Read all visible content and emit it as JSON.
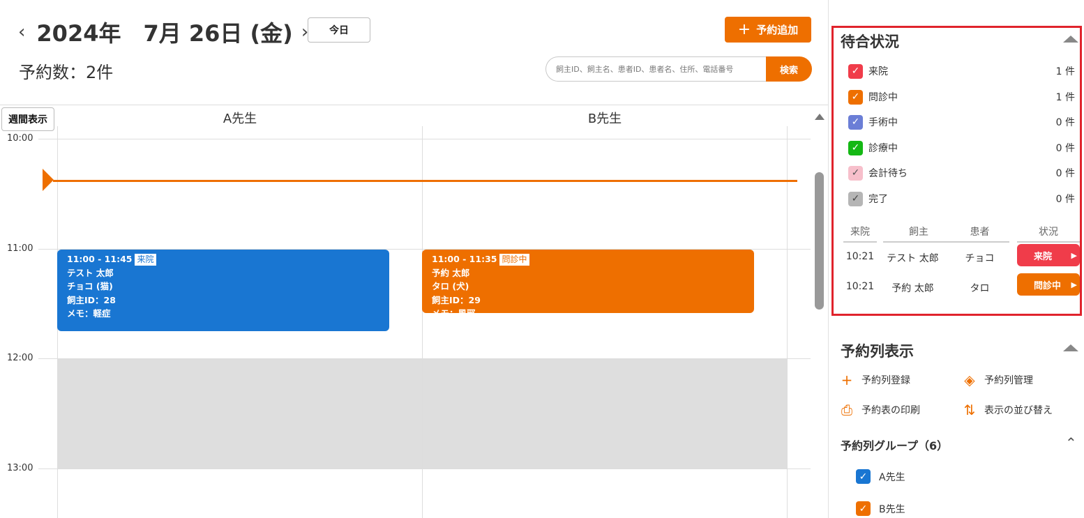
{
  "header": {
    "prev_icon": "chevron-left",
    "next_icon": "chevron-right",
    "date": "2024年　7月 26日 (金)",
    "today_label": "今日",
    "count": "予約数：2件",
    "add_label": "予約追加",
    "search_placeholder": "飼主ID、飼主名、患者ID、患者名、住所、電話番号",
    "search_label": "検索"
  },
  "calendar": {
    "week_view_label": "週間表示",
    "columns": [
      "A先生",
      "B先生"
    ],
    "times": [
      "10:00",
      "11:00",
      "12:00",
      "13:00"
    ],
    "appointments": [
      {
        "time": "11:00 - 11:45",
        "status": "来院",
        "owner": "テスト 太郎",
        "patient": "チョコ (猫)",
        "owner_id": "飼主ID：28",
        "memo": "メモ：軽症",
        "color": "#1976d2"
      },
      {
        "time": "11:00 - 11:35",
        "status": "問診中",
        "owner": "予約 太郎",
        "patient": "タロ (犬)",
        "owner_id": "飼主ID：29",
        "memo": "メモ：風邪",
        "color": "#ee6f00"
      }
    ]
  },
  "waiting": {
    "title": "待合状況",
    "statuses": [
      {
        "label": "来院",
        "count": "1 件",
        "color": "#f03c4a"
      },
      {
        "label": "問診中",
        "count": "1 件",
        "color": "#ee6f00"
      },
      {
        "label": "手術中",
        "count": "0 件",
        "color": "#6b7ed6"
      },
      {
        "label": "診療中",
        "count": "0 件",
        "color": "#14b814"
      },
      {
        "label": "会計待ち",
        "count": "0 件",
        "color": "#f7bfcb"
      },
      {
        "label": "完了",
        "count": "0 件",
        "color": "#b5b5b5"
      }
    ],
    "table_headers": [
      "来院",
      "飼主",
      "患者",
      "状況"
    ],
    "rows": [
      {
        "arrival": "10:21",
        "owner": "テスト 太郎",
        "patient": "チョコ",
        "status": "来院",
        "color": "#f03c4a"
      },
      {
        "arrival": "10:21",
        "owner": "予約 太郎",
        "patient": "タロ",
        "status": "問診中",
        "color": "#ee6f00"
      }
    ]
  },
  "columns_panel": {
    "title": "予約列表示",
    "actions": {
      "register": "予約列登録",
      "manage": "予約列管理",
      "print": "予約表の印刷",
      "reorder": "表示の並び替え"
    },
    "group_title": "予約列グループ（6）",
    "groups": [
      {
        "label": "A先生",
        "color": "#1976d2"
      },
      {
        "label": "B先生",
        "color": "#ee6f00"
      }
    ]
  },
  "colors": {
    "accent": "#ee6f00",
    "blue": "#1976d2",
    "highlight_border": "#e0232c"
  }
}
